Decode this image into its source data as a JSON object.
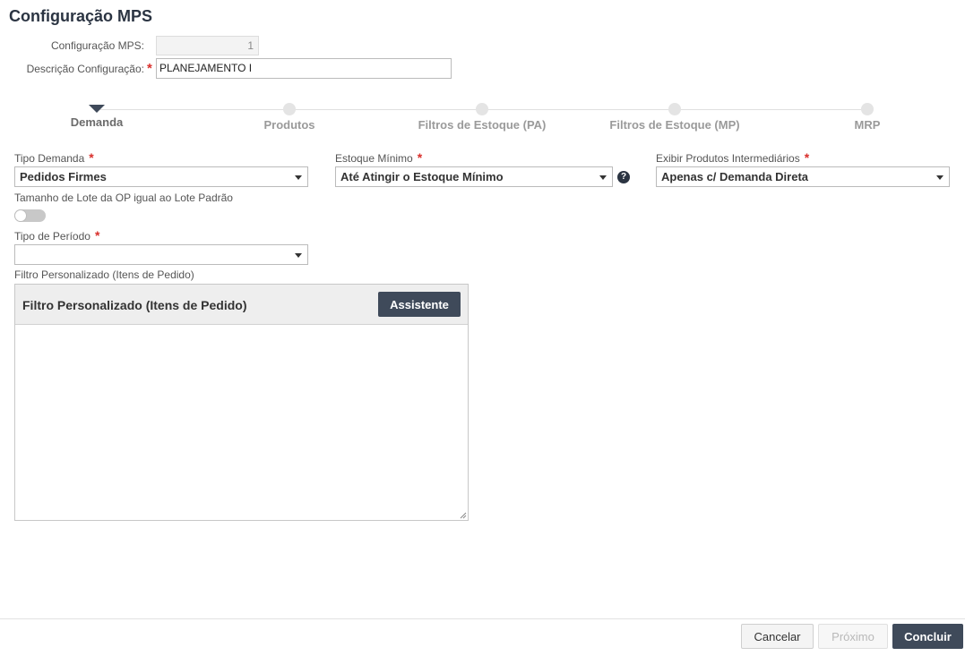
{
  "page": {
    "title": "Configuração MPS"
  },
  "header": {
    "config_label": "Configuração MPS:",
    "config_value": "1",
    "desc_label": "Descrição Configuração:",
    "desc_value": "PLANEJAMENTO I",
    "required_mark": "*"
  },
  "steps": [
    {
      "label": "Demanda",
      "active": true
    },
    {
      "label": "Produtos",
      "active": false
    },
    {
      "label": "Filtros de Estoque (PA)",
      "active": false
    },
    {
      "label": "Filtros de Estoque (MP)",
      "active": false
    },
    {
      "label": "MRP",
      "active": false
    }
  ],
  "form": {
    "tipo_demanda": {
      "label": "Tipo Demanda",
      "value": "Pedidos Firmes"
    },
    "estoque_minimo": {
      "label": "Estoque Mínimo",
      "value": "Até Atingir o Estoque Mínimo",
      "help_icon": "?"
    },
    "exibir_intermediarios": {
      "label": "Exibir Produtos Intermediários",
      "value": "Apenas c/ Demanda Direta"
    },
    "tamanho_lote": {
      "label": "Tamanho de Lote da OP igual ao Lote Padrão",
      "checked": false
    },
    "tipo_periodo": {
      "label": "Tipo de Período",
      "value": ""
    },
    "filtro": {
      "label": "Filtro Personalizado (Itens de Pedido)",
      "title": "Filtro Personalizado (Itens de Pedido)",
      "button": "Assistente",
      "content": ""
    }
  },
  "footer": {
    "cancel": "Cancelar",
    "next": "Próximo",
    "finish": "Concluir"
  },
  "colors": {
    "accent": "#3f4a5a",
    "required": "#d9302c",
    "step_dot": "#e4e4e4"
  }
}
